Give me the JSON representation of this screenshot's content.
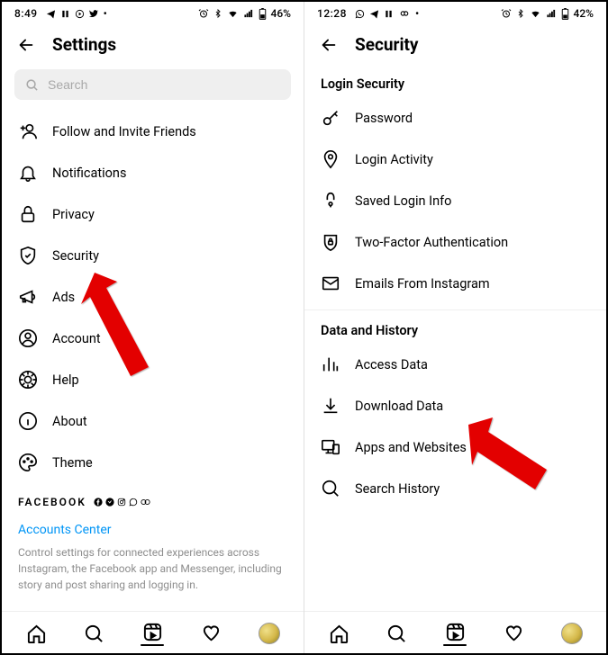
{
  "left": {
    "status": {
      "time": "8:49",
      "battery": "46%"
    },
    "header": {
      "title": "Settings"
    },
    "search": {
      "placeholder": "Search"
    },
    "items": [
      {
        "label": "Follow and Invite Friends"
      },
      {
        "label": "Notifications"
      },
      {
        "label": "Privacy"
      },
      {
        "label": "Security"
      },
      {
        "label": "Ads"
      },
      {
        "label": "Account"
      },
      {
        "label": "Help"
      },
      {
        "label": "About"
      },
      {
        "label": "Theme"
      }
    ],
    "facebook": {
      "brand": "FACEBOOK",
      "accounts": "Accounts Center",
      "desc": "Control settings for connected experiences across Instagram, the Facebook app and Messenger, including story and post sharing and logging in."
    }
  },
  "right": {
    "status": {
      "time": "12:28",
      "battery": "42%"
    },
    "header": {
      "title": "Security"
    },
    "section1": {
      "title": "Login Security"
    },
    "login_items": [
      {
        "label": "Password"
      },
      {
        "label": "Login Activity"
      },
      {
        "label": "Saved Login Info"
      },
      {
        "label": "Two-Factor Authentication"
      },
      {
        "label": "Emails From Instagram"
      }
    ],
    "section2": {
      "title": "Data and History"
    },
    "data_items": [
      {
        "label": "Access Data"
      },
      {
        "label": "Download Data"
      },
      {
        "label": "Apps and Websites"
      },
      {
        "label": "Search History"
      }
    ]
  }
}
